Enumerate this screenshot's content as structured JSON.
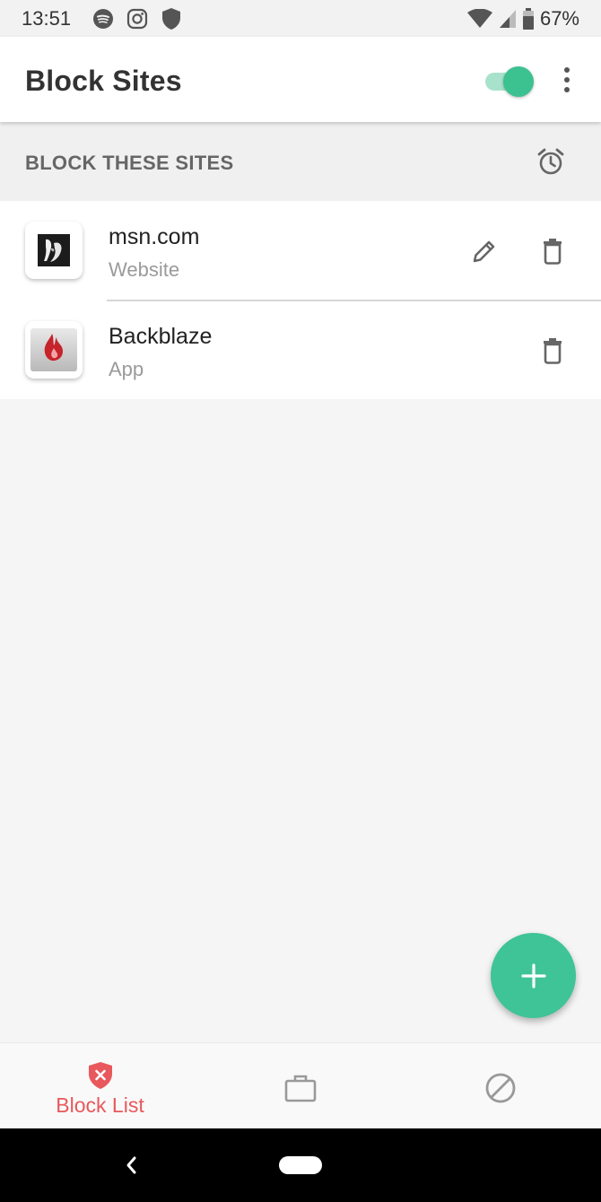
{
  "status_bar": {
    "time": "13:51",
    "icons": [
      "spotify-icon",
      "instagram-icon",
      "shield-icon"
    ],
    "right_icons": [
      "wifi-icon",
      "signal-icon",
      "battery-icon"
    ],
    "battery": "67%"
  },
  "app_bar": {
    "title": "Block Sites",
    "toggle_on": true,
    "menu_icon": "overflow-menu-icon"
  },
  "section": {
    "title": "BLOCK THESE SITES",
    "icon": "alarm-icon"
  },
  "items": [
    {
      "title": "msn.com",
      "subtitle": "Website",
      "icon": "msn-icon",
      "editable": true
    },
    {
      "title": "Backblaze",
      "subtitle": "App",
      "icon": "backblaze-icon",
      "editable": false
    }
  ],
  "fab": {
    "icon": "plus-icon"
  },
  "bottom_nav": {
    "items": [
      {
        "label": "Block List",
        "icon": "shield-x-icon",
        "active": true
      },
      {
        "label": "",
        "icon": "briefcase-icon",
        "active": false
      },
      {
        "label": "",
        "icon": "blocked-icon",
        "active": false
      }
    ]
  },
  "colors": {
    "accent": "#3ec497",
    "active_nav": "#e8585c",
    "toggle_track": "#a9e2cc"
  }
}
